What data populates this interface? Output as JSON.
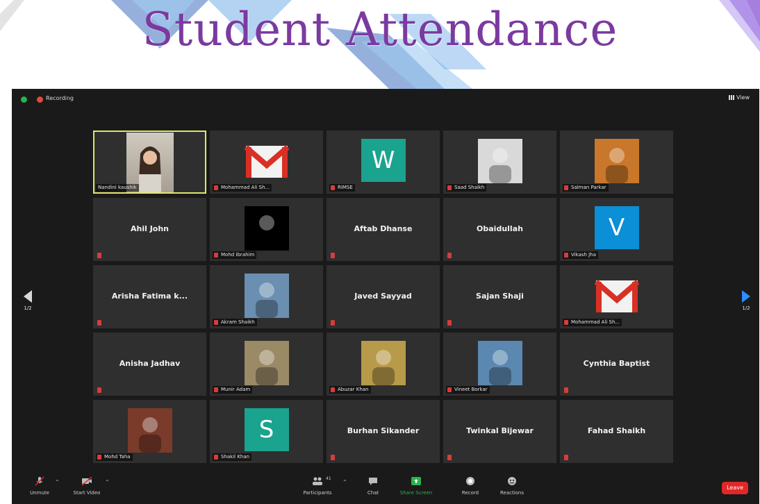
{
  "slide": {
    "title": "Student Attendance"
  },
  "meeting": {
    "recording_label": "Recording",
    "view_label": "View",
    "page_left": "1/2",
    "page_right": "1/2"
  },
  "tiles": [
    {
      "label": "Nandini kaushik",
      "kind": "video"
    },
    {
      "label": "Mohammad Ali Sh...",
      "kind": "gmail"
    },
    {
      "label": "RIMSE",
      "kind": "letter",
      "letter": "W",
      "color": "#1aa38e"
    },
    {
      "label": "Saad Shaikh",
      "kind": "photo",
      "bg": "#d9d9d9"
    },
    {
      "label": "Salman Parkar",
      "kind": "photo",
      "bg": "#c9772a"
    },
    {
      "center": "Ahil John",
      "kind": "name"
    },
    {
      "label": "Mohd Ibrahim",
      "kind": "photo",
      "bg": "#000000"
    },
    {
      "center": "Aftab Dhanse",
      "kind": "name"
    },
    {
      "center": "Obaidullah",
      "kind": "name"
    },
    {
      "label": "Vikash Jha",
      "kind": "letter",
      "letter": "V",
      "color": "#0b8fd6"
    },
    {
      "center": "Arisha Fatima k...",
      "kind": "name"
    },
    {
      "label": "Akram Shaikh",
      "kind": "photo",
      "bg": "#6a8fb0"
    },
    {
      "center": "Javed Sayyad",
      "kind": "name"
    },
    {
      "center": "Sajan  Shaji",
      "kind": "name"
    },
    {
      "label": "Mohammad Ali Sh...",
      "kind": "gmail"
    },
    {
      "center": "Anisha Jadhav",
      "kind": "name"
    },
    {
      "label": "Munir Adam",
      "kind": "photo",
      "bg": "#9a8a66"
    },
    {
      "label": "Abuzar Khan",
      "kind": "photo",
      "bg": "#b79a4a"
    },
    {
      "label": "Vineet Borkar",
      "kind": "photo",
      "bg": "#5b88b0"
    },
    {
      "center": "Cynthia Baptist",
      "kind": "name"
    },
    {
      "label": "Mohd Taha",
      "kind": "photo",
      "bg": "#7a3b2a"
    },
    {
      "label": "Shakil Khan",
      "kind": "letter",
      "letter": "S",
      "color": "#1aa38e"
    },
    {
      "center": "Burhan Sikander",
      "kind": "name"
    },
    {
      "center": "Twinkal Bijewar",
      "kind": "name"
    },
    {
      "center": "Fahad Shaikh",
      "kind": "name"
    }
  ],
  "toolbar": {
    "unmute": "Unmute",
    "start_video": "Start Video",
    "participants": "Participants",
    "participants_count": "41",
    "chat": "Chat",
    "share_screen": "Share Screen",
    "record": "Record",
    "reactions": "Reactions",
    "leave": "Leave"
  },
  "colors": {
    "title_purple": "#7b3aa0",
    "accent_blue": "#2d8cff",
    "leave_red": "#e02828",
    "share_green": "#2bb24c"
  }
}
